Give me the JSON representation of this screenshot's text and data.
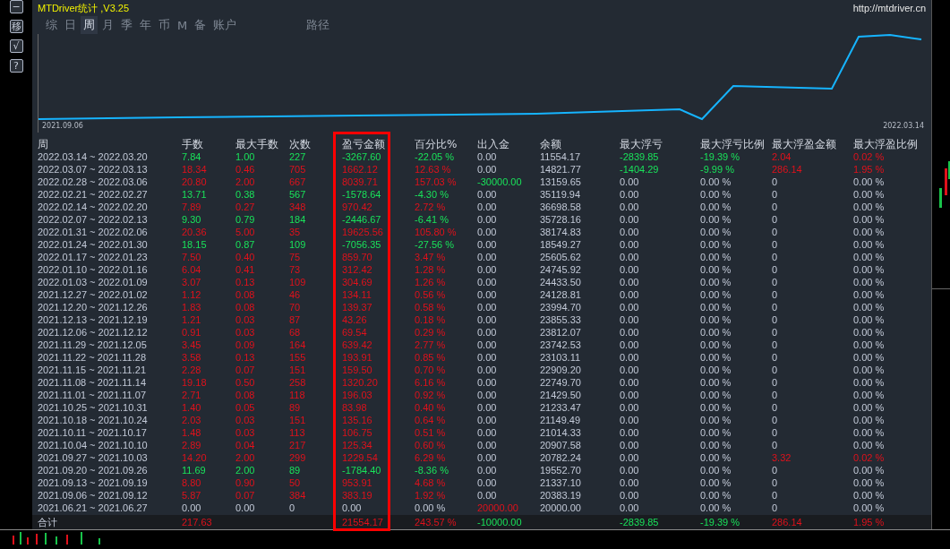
{
  "side_buttons": [
    "−",
    "移",
    "√",
    "?"
  ],
  "window": {
    "title": "MTDriver统计 ,V3.25",
    "url": "http://mtdriver.cn"
  },
  "tabs": [
    {
      "label": "综",
      "selected": false
    },
    {
      "label": "日",
      "selected": false
    },
    {
      "label": "周",
      "selected": true
    },
    {
      "label": "月",
      "selected": false
    },
    {
      "label": "季",
      "selected": false
    },
    {
      "label": "年",
      "selected": false
    },
    {
      "label": "币",
      "selected": false
    },
    {
      "label": "M",
      "selected": false
    },
    {
      "label": "备",
      "selected": false
    },
    {
      "label": "账户",
      "selected": false
    },
    {
      "label": "路径",
      "selected": false
    }
  ],
  "chart": {
    "start_label": "2021.09.06",
    "end_label": "2022.03.14"
  },
  "table": {
    "columns": [
      "周",
      "手数",
      "最大手数",
      "次数",
      "盈亏金额",
      "百分比%",
      "出入金",
      "余额",
      "最大浮亏",
      "最大浮亏比例",
      "最大浮盈金额",
      "最大浮盈比例"
    ],
    "rows": [
      {
        "week": "2022.03.14 ~ 2022.03.20",
        "kind": "loss",
        "lots": "7.84",
        "max_lots": "1.00",
        "trades": "227",
        "pnl": "-3267.60",
        "pct": "-22.05 %",
        "deposit": "0.00",
        "deposited": false,
        "withdrawn": false,
        "balance": "11554.17",
        "max_loss": "-2839.85",
        "max_loss_pct": "-19.39 %",
        "float_loss": true,
        "max_profit": "2.04",
        "max_profit_pct": "0.02 %",
        "float_profit": true
      },
      {
        "week": "2022.03.07 ~ 2022.03.13",
        "kind": "gain",
        "lots": "18.34",
        "max_lots": "0.46",
        "trades": "705",
        "pnl": "1662.12",
        "pct": "12.63 %",
        "deposit": "0.00",
        "deposited": false,
        "withdrawn": false,
        "balance": "14821.77",
        "max_loss": "-1404.29",
        "max_loss_pct": "-9.99 %",
        "float_loss": true,
        "max_profit": "286.14",
        "max_profit_pct": "1.95 %",
        "float_profit": true
      },
      {
        "week": "2022.02.28 ~ 2022.03.06",
        "kind": "gain",
        "lots": "20.80",
        "max_lots": "2.00",
        "trades": "667",
        "pnl": "8039.71",
        "pct": "157.03 %",
        "deposit": "-30000.00",
        "deposited": false,
        "withdrawn": true,
        "balance": "13159.65",
        "max_loss": "0.00",
        "max_loss_pct": "0.00 %",
        "float_loss": false,
        "max_profit": "0",
        "max_profit_pct": "0.00 %",
        "float_profit": false
      },
      {
        "week": "2022.02.21 ~ 2022.02.27",
        "kind": "loss",
        "lots": "13.71",
        "max_lots": "0.38",
        "trades": "567",
        "pnl": "-1578.64",
        "pct": "-4.30 %",
        "deposit": "0.00",
        "deposited": false,
        "withdrawn": false,
        "balance": "35119.94",
        "max_loss": "0.00",
        "max_loss_pct": "0.00 %",
        "float_loss": false,
        "max_profit": "0",
        "max_profit_pct": "0.00 %",
        "float_profit": false
      },
      {
        "week": "2022.02.14 ~ 2022.02.20",
        "kind": "gain",
        "lots": "7.89",
        "max_lots": "0.27",
        "trades": "348",
        "pnl": "970.42",
        "pct": "2.72 %",
        "deposit": "0.00",
        "deposited": false,
        "withdrawn": false,
        "balance": "36698.58",
        "max_loss": "0.00",
        "max_loss_pct": "0.00 %",
        "float_loss": false,
        "max_profit": "0",
        "max_profit_pct": "0.00 %",
        "float_profit": false
      },
      {
        "week": "2022.02.07 ~ 2022.02.13",
        "kind": "loss",
        "lots": "9.30",
        "max_lots": "0.79",
        "trades": "184",
        "pnl": "-2446.67",
        "pct": "-6.41 %",
        "deposit": "0.00",
        "deposited": false,
        "withdrawn": false,
        "balance": "35728.16",
        "max_loss": "0.00",
        "max_loss_pct": "0.00 %",
        "float_loss": false,
        "max_profit": "0",
        "max_profit_pct": "0.00 %",
        "float_profit": false
      },
      {
        "week": "2022.01.31 ~ 2022.02.06",
        "kind": "gain",
        "lots": "20.36",
        "max_lots": "5.00",
        "trades": "35",
        "pnl": "19625.56",
        "pct": "105.80 %",
        "deposit": "0.00",
        "deposited": false,
        "withdrawn": false,
        "balance": "38174.83",
        "max_loss": "0.00",
        "max_loss_pct": "0.00 %",
        "float_loss": false,
        "max_profit": "0",
        "max_profit_pct": "0.00 %",
        "float_profit": false
      },
      {
        "week": "2022.01.24 ~ 2022.01.30",
        "kind": "loss",
        "lots": "18.15",
        "max_lots": "0.87",
        "trades": "109",
        "pnl": "-7056.35",
        "pct": "-27.56 %",
        "deposit": "0.00",
        "deposited": false,
        "withdrawn": false,
        "balance": "18549.27",
        "max_loss": "0.00",
        "max_loss_pct": "0.00 %",
        "float_loss": false,
        "max_profit": "0",
        "max_profit_pct": "0.00 %",
        "float_profit": false
      },
      {
        "week": "2022.01.17 ~ 2022.01.23",
        "kind": "gain",
        "lots": "7.50",
        "max_lots": "0.40",
        "trades": "75",
        "pnl": "859.70",
        "pct": "3.47 %",
        "deposit": "0.00",
        "deposited": false,
        "withdrawn": false,
        "balance": "25605.62",
        "max_loss": "0.00",
        "max_loss_pct": "0.00 %",
        "float_loss": false,
        "max_profit": "0",
        "max_profit_pct": "0.00 %",
        "float_profit": false
      },
      {
        "week": "2022.01.10 ~ 2022.01.16",
        "kind": "gain",
        "lots": "6.04",
        "max_lots": "0.41",
        "trades": "73",
        "pnl": "312.42",
        "pct": "1.28 %",
        "deposit": "0.00",
        "deposited": false,
        "withdrawn": false,
        "balance": "24745.92",
        "max_loss": "0.00",
        "max_loss_pct": "0.00 %",
        "float_loss": false,
        "max_profit": "0",
        "max_profit_pct": "0.00 %",
        "float_profit": false
      },
      {
        "week": "2022.01.03 ~ 2022.01.09",
        "kind": "gain",
        "lots": "3.07",
        "max_lots": "0.13",
        "trades": "109",
        "pnl": "304.69",
        "pct": "1.26 %",
        "deposit": "0.00",
        "deposited": false,
        "withdrawn": false,
        "balance": "24433.50",
        "max_loss": "0.00",
        "max_loss_pct": "0.00 %",
        "float_loss": false,
        "max_profit": "0",
        "max_profit_pct": "0.00 %",
        "float_profit": false
      },
      {
        "week": "2021.12.27 ~ 2022.01.02",
        "kind": "gain",
        "lots": "1.12",
        "max_lots": "0.08",
        "trades": "46",
        "pnl": "134.11",
        "pct": "0.56 %",
        "deposit": "0.00",
        "deposited": false,
        "withdrawn": false,
        "balance": "24128.81",
        "max_loss": "0.00",
        "max_loss_pct": "0.00 %",
        "float_loss": false,
        "max_profit": "0",
        "max_profit_pct": "0.00 %",
        "float_profit": false
      },
      {
        "week": "2021.12.20 ~ 2021.12.26",
        "kind": "gain",
        "lots": "1.83",
        "max_lots": "0.08",
        "trades": "70",
        "pnl": "139.37",
        "pct": "0.58 %",
        "deposit": "0.00",
        "deposited": false,
        "withdrawn": false,
        "balance": "23994.70",
        "max_loss": "0.00",
        "max_loss_pct": "0.00 %",
        "float_loss": false,
        "max_profit": "0",
        "max_profit_pct": "0.00 %",
        "float_profit": false
      },
      {
        "week": "2021.12.13 ~ 2021.12.19",
        "kind": "gain",
        "lots": "1.21",
        "max_lots": "0.03",
        "trades": "87",
        "pnl": "43.26",
        "pct": "0.18 %",
        "deposit": "0.00",
        "deposited": false,
        "withdrawn": false,
        "balance": "23855.33",
        "max_loss": "0.00",
        "max_loss_pct": "0.00 %",
        "float_loss": false,
        "max_profit": "0",
        "max_profit_pct": "0.00 %",
        "float_profit": false
      },
      {
        "week": "2021.12.06 ~ 2021.12.12",
        "kind": "gain",
        "lots": "0.91",
        "max_lots": "0.03",
        "trades": "68",
        "pnl": "69.54",
        "pct": "0.29 %",
        "deposit": "0.00",
        "deposited": false,
        "withdrawn": false,
        "balance": "23812.07",
        "max_loss": "0.00",
        "max_loss_pct": "0.00 %",
        "float_loss": false,
        "max_profit": "0",
        "max_profit_pct": "0.00 %",
        "float_profit": false
      },
      {
        "week": "2021.11.29 ~ 2021.12.05",
        "kind": "gain",
        "lots": "3.45",
        "max_lots": "0.09",
        "trades": "164",
        "pnl": "639.42",
        "pct": "2.77 %",
        "deposit": "0.00",
        "deposited": false,
        "withdrawn": false,
        "balance": "23742.53",
        "max_loss": "0.00",
        "max_loss_pct": "0.00 %",
        "float_loss": false,
        "max_profit": "0",
        "max_profit_pct": "0.00 %",
        "float_profit": false
      },
      {
        "week": "2021.11.22 ~ 2021.11.28",
        "kind": "gain",
        "lots": "3.58",
        "max_lots": "0.13",
        "trades": "155",
        "pnl": "193.91",
        "pct": "0.85 %",
        "deposit": "0.00",
        "deposited": false,
        "withdrawn": false,
        "balance": "23103.11",
        "max_loss": "0.00",
        "max_loss_pct": "0.00 %",
        "float_loss": false,
        "max_profit": "0",
        "max_profit_pct": "0.00 %",
        "float_profit": false
      },
      {
        "week": "2021.11.15 ~ 2021.11.21",
        "kind": "gain",
        "lots": "2.28",
        "max_lots": "0.07",
        "trades": "151",
        "pnl": "159.50",
        "pct": "0.70 %",
        "deposit": "0.00",
        "deposited": false,
        "withdrawn": false,
        "balance": "22909.20",
        "max_loss": "0.00",
        "max_loss_pct": "0.00 %",
        "float_loss": false,
        "max_profit": "0",
        "max_profit_pct": "0.00 %",
        "float_profit": false
      },
      {
        "week": "2021.11.08 ~ 2021.11.14",
        "kind": "gain",
        "lots": "19.18",
        "max_lots": "0.50",
        "trades": "258",
        "pnl": "1320.20",
        "pct": "6.16 %",
        "deposit": "0.00",
        "deposited": false,
        "withdrawn": false,
        "balance": "22749.70",
        "max_loss": "0.00",
        "max_loss_pct": "0.00 %",
        "float_loss": false,
        "max_profit": "0",
        "max_profit_pct": "0.00 %",
        "float_profit": false
      },
      {
        "week": "2021.11.01 ~ 2021.11.07",
        "kind": "gain",
        "lots": "2.71",
        "max_lots": "0.08",
        "trades": "118",
        "pnl": "196.03",
        "pct": "0.92 %",
        "deposit": "0.00",
        "deposited": false,
        "withdrawn": false,
        "balance": "21429.50",
        "max_loss": "0.00",
        "max_loss_pct": "0.00 %",
        "float_loss": false,
        "max_profit": "0",
        "max_profit_pct": "0.00 %",
        "float_profit": false
      },
      {
        "week": "2021.10.25 ~ 2021.10.31",
        "kind": "gain",
        "lots": "1.40",
        "max_lots": "0.05",
        "trades": "89",
        "pnl": "83.98",
        "pct": "0.40 %",
        "deposit": "0.00",
        "deposited": false,
        "withdrawn": false,
        "balance": "21233.47",
        "max_loss": "0.00",
        "max_loss_pct": "0.00 %",
        "float_loss": false,
        "max_profit": "0",
        "max_profit_pct": "0.00 %",
        "float_profit": false
      },
      {
        "week": "2021.10.18 ~ 2021.10.24",
        "kind": "gain",
        "lots": "2.03",
        "max_lots": "0.03",
        "trades": "151",
        "pnl": "135.16",
        "pct": "0.64 %",
        "deposit": "0.00",
        "deposited": false,
        "withdrawn": false,
        "balance": "21149.49",
        "max_loss": "0.00",
        "max_loss_pct": "0.00 %",
        "float_loss": false,
        "max_profit": "0",
        "max_profit_pct": "0.00 %",
        "float_profit": false
      },
      {
        "week": "2021.10.11 ~ 2021.10.17",
        "kind": "gain",
        "lots": "1.48",
        "max_lots": "0.03",
        "trades": "113",
        "pnl": "106.75",
        "pct": "0.51 %",
        "deposit": "0.00",
        "deposited": false,
        "withdrawn": false,
        "balance": "21014.33",
        "max_loss": "0.00",
        "max_loss_pct": "0.00 %",
        "float_loss": false,
        "max_profit": "0",
        "max_profit_pct": "0.00 %",
        "float_profit": false
      },
      {
        "week": "2021.10.04 ~ 2021.10.10",
        "kind": "gain",
        "lots": "2.89",
        "max_lots": "0.04",
        "trades": "217",
        "pnl": "125.34",
        "pct": "0.60 %",
        "deposit": "0.00",
        "deposited": false,
        "withdrawn": false,
        "balance": "20907.58",
        "max_loss": "0.00",
        "max_loss_pct": "0.00 %",
        "float_loss": false,
        "max_profit": "0",
        "max_profit_pct": "0.00 %",
        "float_profit": false
      },
      {
        "week": "2021.09.27 ~ 2021.10.03",
        "kind": "gain",
        "lots": "14.20",
        "max_lots": "2.00",
        "trades": "299",
        "pnl": "1229.54",
        "pct": "6.29 %",
        "deposit": "0.00",
        "deposited": false,
        "withdrawn": false,
        "balance": "20782.24",
        "max_loss": "0.00",
        "max_loss_pct": "0.00 %",
        "float_loss": false,
        "max_profit": "3.32",
        "max_profit_pct": "0.02 %",
        "float_profit": true
      },
      {
        "week": "2021.09.20 ~ 2021.09.26",
        "kind": "loss",
        "lots": "11.69",
        "max_lots": "2.00",
        "trades": "89",
        "pnl": "-1784.40",
        "pct": "-8.36 %",
        "deposit": "0.00",
        "deposited": false,
        "withdrawn": false,
        "balance": "19552.70",
        "max_loss": "0.00",
        "max_loss_pct": "0.00 %",
        "float_loss": false,
        "max_profit": "0",
        "max_profit_pct": "0.00 %",
        "float_profit": false
      },
      {
        "week": "2021.09.13 ~ 2021.09.19",
        "kind": "gain",
        "lots": "8.80",
        "max_lots": "0.90",
        "trades": "50",
        "pnl": "953.91",
        "pct": "4.68 %",
        "deposit": "0.00",
        "deposited": false,
        "withdrawn": false,
        "balance": "21337.10",
        "max_loss": "0.00",
        "max_loss_pct": "0.00 %",
        "float_loss": false,
        "max_profit": "0",
        "max_profit_pct": "0.00 %",
        "float_profit": false
      },
      {
        "week": "2021.09.06 ~ 2021.09.12",
        "kind": "gain",
        "lots": "5.87",
        "max_lots": "0.07",
        "trades": "384",
        "pnl": "383.19",
        "pct": "1.92 %",
        "deposit": "0.00",
        "deposited": false,
        "withdrawn": false,
        "balance": "20383.19",
        "max_loss": "0.00",
        "max_loss_pct": "0.00 %",
        "float_loss": false,
        "max_profit": "0",
        "max_profit_pct": "0.00 %",
        "float_profit": false
      },
      {
        "week": "2021.06.21 ~ 2021.06.27",
        "kind": "flat",
        "lots": "0.00",
        "max_lots": "0.00",
        "trades": "0",
        "pnl": "0.00",
        "pct": "0.00 %",
        "deposit": "20000.00",
        "deposited": true,
        "withdrawn": false,
        "balance": "20000.00",
        "max_loss": "0.00",
        "max_loss_pct": "0.00 %",
        "float_loss": false,
        "max_profit": "0",
        "max_profit_pct": "0.00 %",
        "float_profit": false
      }
    ],
    "totals": {
      "label": "合计",
      "kind": "gain",
      "lots": "217.63",
      "pnl": "21554.17",
      "pct": "243.57 %",
      "deposit": "-10000.00",
      "deposited": false,
      "withdrawn": true,
      "max_loss": "-2839.85",
      "max_loss_pct": "-19.39 %",
      "float_loss": true,
      "max_profit": "286.14",
      "max_profit_pct": "1.95 %",
      "float_profit": true
    }
  }
}
